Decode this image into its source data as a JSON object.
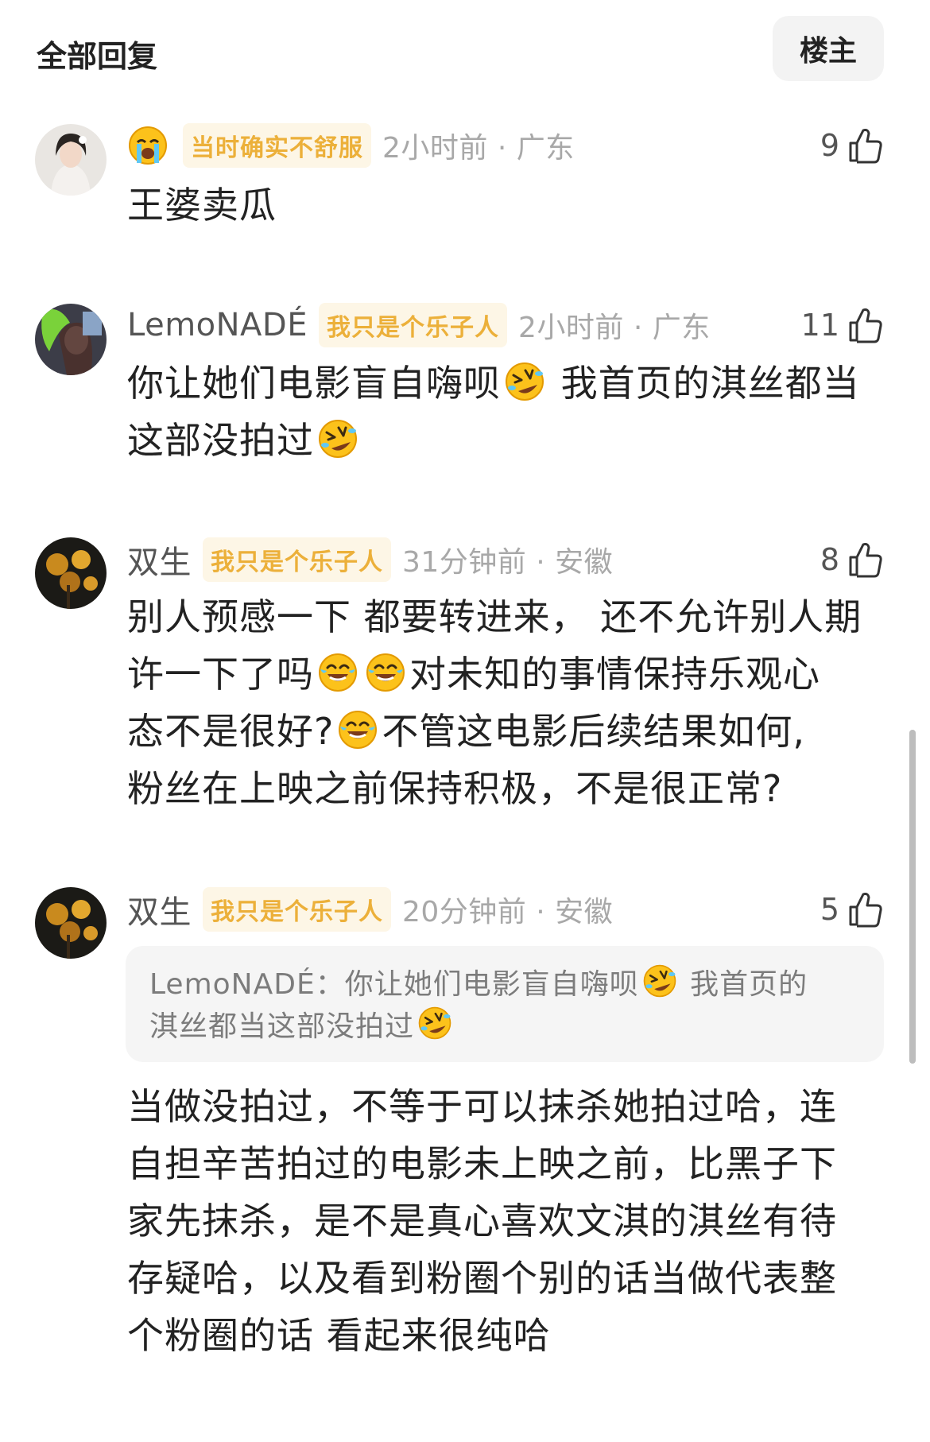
{
  "header": {
    "title": "全部回复",
    "owner_button": "楼主"
  },
  "comments": [
    {
      "username": "",
      "mood_emoji": "crying-emoji",
      "badge": "当时确实不舒服",
      "time": "2小时前 · 广东",
      "likes": "9",
      "text": "王婆卖瓜"
    },
    {
      "username": "LemoNADÉ",
      "badge": "我只是个乐子人",
      "time": "2小时前 · 广东",
      "likes": "11",
      "text_1": "你让她们电影盲自嗨呗",
      "text_2": "我首页的淇丝都当",
      "text_3": "这部没拍过"
    },
    {
      "username": "双生",
      "badge": "我只是个乐子人",
      "time": "31分钟前 · 安徽",
      "likes": "8",
      "text_1": "别人预感一下 都要转进来， 还不允许别人期",
      "text_2": "许一下了吗",
      "text_3": "对未知的事情保持乐观心",
      "text_4": "态不是很好?",
      "text_5": "不管这电影后续结果如何,",
      "text_6": "粉丝在上映之前保持积极，不是很正常?"
    },
    {
      "username": "双生",
      "badge": "我只是个乐子人",
      "time": "20分钟前 · 安徽",
      "likes": "5",
      "quote_user": "LemoNADÉ：",
      "quote_1": "你让她们电影盲自嗨呗",
      "quote_2": "我首页的",
      "quote_3": "淇丝都当这部没拍过",
      "lines": [
        "当做没拍过，不等于可以抹杀她拍过哈，连",
        "自担辛苦拍过的电影未上映之前，比黑子下",
        "家先抹杀，是不是真心喜欢文淇的淇丝有待",
        "存疑哈，以及看到粉圈个别的话当做代表整",
        "个粉圈的话 看起来很纯哈"
      ]
    }
  ],
  "icons": {
    "like": "thumbs-up-icon",
    "laugh_roll": "rolling-laughing-emoji",
    "tears_joy": "tears-of-joy-emoji"
  },
  "colors": {
    "badge_text": "#ecb03a",
    "badge_bg": "#fdf6e6",
    "meta_text": "#a8a8a8",
    "quote_bg": "#f5f5f5"
  }
}
